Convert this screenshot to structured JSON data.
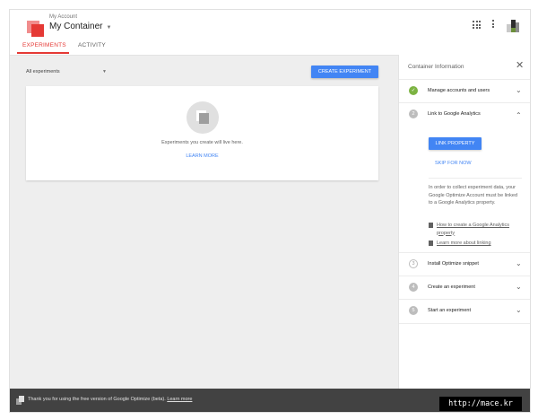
{
  "header": {
    "account_label": "My Account",
    "container_name": "My Container",
    "avatar_colors": [
      "#2e2e2e",
      "#8d8d8d",
      "#6c8f3a",
      "#c9c9c9"
    ]
  },
  "tabs": [
    {
      "label": "EXPERIMENTS",
      "active": true
    },
    {
      "label": "ACTIVITY",
      "active": false
    }
  ],
  "main": {
    "filter": {
      "selected": "All experiments"
    },
    "create_button": "CREATE EXPERIMENT",
    "empty_state": {
      "message": "Experiments you create will live here.",
      "learn_more": "LEARN MORE"
    }
  },
  "panel": {
    "title": "Container Information",
    "steps": [
      {
        "num": "",
        "label": "Manage accounts and users",
        "state": "done",
        "expanded": false
      },
      {
        "num": "2",
        "label": "Link to Google Analytics",
        "state": "current",
        "expanded": true
      },
      {
        "num": "3",
        "label": "Install Optimize snippet",
        "state": "pending",
        "expanded": false
      },
      {
        "num": "4",
        "label": "Create an experiment",
        "state": "pending",
        "expanded": false
      },
      {
        "num": "5",
        "label": "Start an experiment",
        "state": "pending",
        "expanded": false
      }
    ],
    "link_button": "LINK PROPERTY",
    "skip_label": "SKIP FOR NOW",
    "description": "In order to collect experiment data, your Google Optimize Account must be linked to a Google Analytics property.",
    "docs": [
      "How to create a Google Analytics property",
      "Learn more about linking"
    ]
  },
  "footer": {
    "message": "Thank you for using the free version of Google Optimize (beta).",
    "link": "Learn more"
  },
  "watermark": "http://mace.kr",
  "colors": {
    "accent": "#e53935",
    "primary": "#4285f4",
    "done": "#7cb342",
    "footer_bg": "#424242"
  }
}
